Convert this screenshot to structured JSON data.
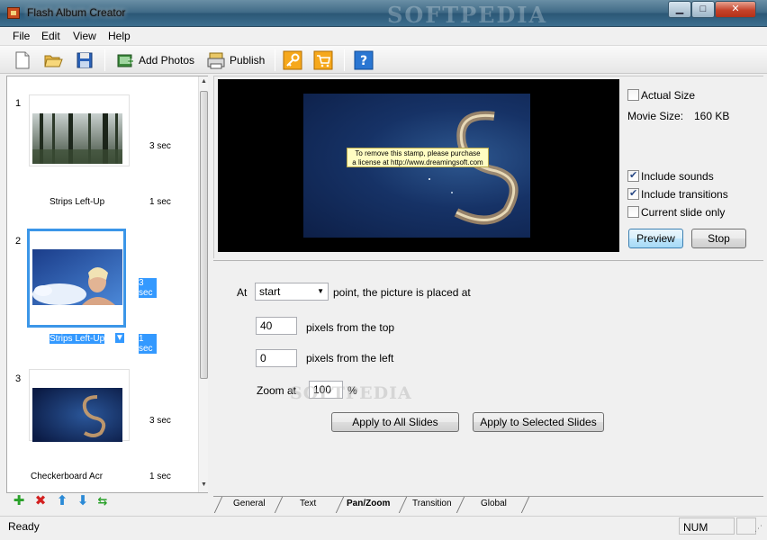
{
  "window": {
    "title": "Flash Album Creator",
    "watermark": "SOFTPEDIA"
  },
  "menu": {
    "items": [
      "File",
      "Edit",
      "View",
      "Help"
    ]
  },
  "toolbar": {
    "add_photos": "Add Photos",
    "publish": "Publish"
  },
  "slides": [
    {
      "number": "1",
      "duration": "3 sec",
      "transition": "Strips Left-Up",
      "transition_duration": "1 sec"
    },
    {
      "number": "2",
      "duration": "3 sec",
      "transition": "Strips Left-Up",
      "transition_duration": "1 sec"
    },
    {
      "number": "3",
      "duration": "3 sec",
      "transition": "Checkerboard Acr",
      "transition_duration": "1 sec"
    }
  ],
  "preview": {
    "stamp_line1": "To remove this stamp, please purchase",
    "stamp_line2": "a license at http://www.dreamingsoft.com",
    "actual_size": "Actual Size",
    "movie_size_label": "Movie Size:",
    "movie_size_value": "160 KB",
    "include_sounds": "Include sounds",
    "include_transitions": "Include transitions",
    "current_slide_only": "Current slide only",
    "actual_size_checked": false,
    "include_sounds_checked": true,
    "include_transitions_checked": true,
    "current_slide_only_checked": false,
    "preview_button": "Preview",
    "stop_button": "Stop"
  },
  "panzoom": {
    "at_label": "At",
    "point_select": "start",
    "point_suffix": "point, the picture is placed at",
    "top_value": "40",
    "top_label": "pixels from the top",
    "left_value": "0",
    "left_label": "pixels from the left",
    "zoom_label": "Zoom at",
    "zoom_value": "100",
    "zoom_unit": "%",
    "apply_all": "Apply to All Slides",
    "apply_selected": "Apply to Selected Slides",
    "watermark": "SOFTPEDIA"
  },
  "tabs": [
    "General",
    "Text",
    "Pan/Zoom",
    "Transition",
    "Global"
  ],
  "status": {
    "text": "Ready",
    "num": "NUM"
  },
  "colors": {
    "selection": "#3399ff",
    "title_bar": "#3f6a86"
  }
}
